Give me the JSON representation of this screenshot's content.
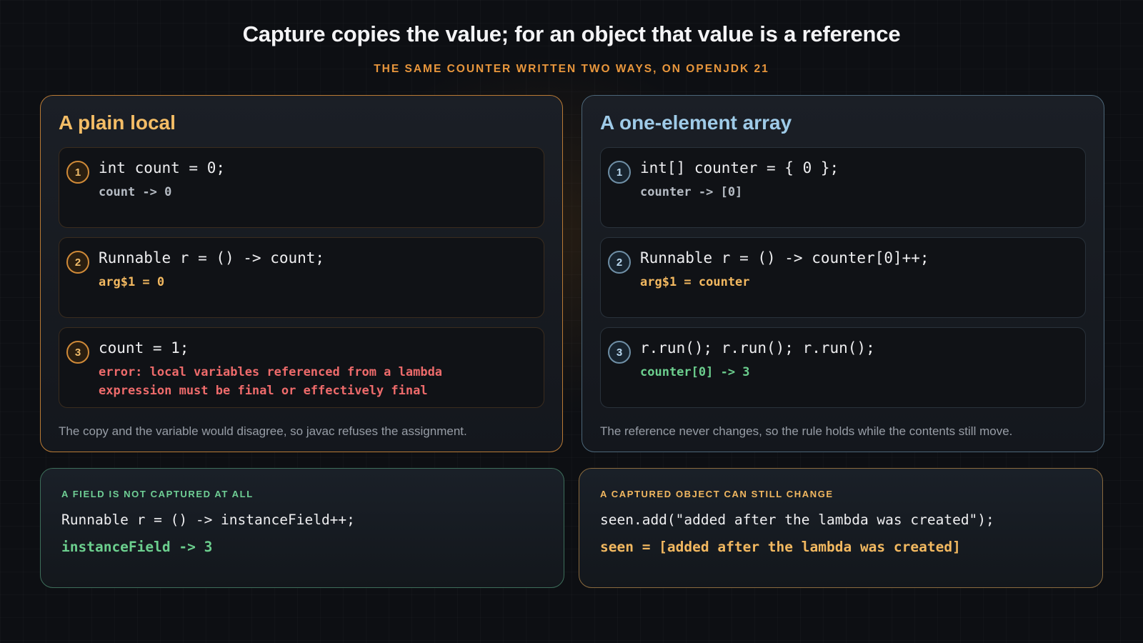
{
  "header": {
    "title": "Capture copies the value; for an object that value is a reference",
    "subtitle": "THE SAME COUNTER WRITTEN TWO WAYS, ON OPENJDK 21"
  },
  "left_panel": {
    "heading": "A plain local",
    "steps": [
      {
        "number": "1",
        "code": "int count = 0;",
        "result": "count -> 0",
        "result_kind": "neutral"
      },
      {
        "number": "2",
        "code": "Runnable r = () -> count;",
        "result": "arg$1 = 0",
        "result_kind": "captured"
      },
      {
        "number": "3",
        "code": "count = 1;",
        "result": "error: local variables referenced from a lambda\nexpression must be final or effectively final",
        "result_kind": "error"
      }
    ],
    "caption": "The copy and the variable would disagree, so javac refuses the assignment."
  },
  "right_panel": {
    "heading": "A one-element array",
    "steps": [
      {
        "number": "1",
        "code": "int[] counter = { 0 };",
        "result": "counter -> [0]",
        "result_kind": "neutral"
      },
      {
        "number": "2",
        "code": "Runnable r = () -> counter[0]++;",
        "result": "arg$1 = counter",
        "result_kind": "captured"
      },
      {
        "number": "3",
        "code": "r.run(); r.run(); r.run();",
        "result": "counter[0] -> 3",
        "result_kind": "success"
      }
    ],
    "caption": "The reference never changes, so the rule holds while the contents still move."
  },
  "notes": {
    "field": {
      "label": "A FIELD IS NOT CAPTURED AT ALL",
      "code": "Runnable r = () -> instanceField++;",
      "result": "instanceField -> 3"
    },
    "object": {
      "label": "A CAPTURED OBJECT CAN STILL CHANGE",
      "code": "seen.add(\"added after the lambda was created\");",
      "result": "seen = [added after the lambda was created]"
    }
  },
  "colors": {
    "accent_orange": "#e8963c",
    "left_heading": "#f4bd66",
    "right_heading": "#9fcbe8",
    "error_red": "#ee6b6b",
    "success_green": "#6ccf8e"
  }
}
